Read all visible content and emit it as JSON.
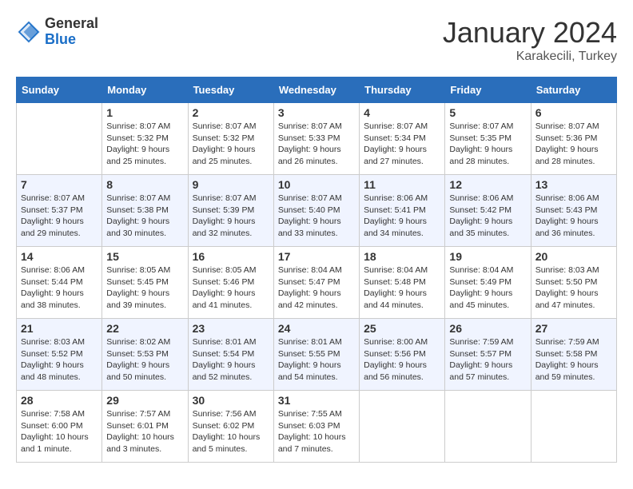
{
  "logo": {
    "general": "General",
    "blue": "Blue"
  },
  "title": {
    "month": "January 2024",
    "location": "Karakecili, Turkey"
  },
  "weekdays": [
    "Sunday",
    "Monday",
    "Tuesday",
    "Wednesday",
    "Thursday",
    "Friday",
    "Saturday"
  ],
  "weeks": [
    [
      {
        "day": null
      },
      {
        "day": 1,
        "sunrise": "8:07 AM",
        "sunset": "5:32 PM",
        "daylight": "9 hours and 25 minutes."
      },
      {
        "day": 2,
        "sunrise": "8:07 AM",
        "sunset": "5:32 PM",
        "daylight": "9 hours and 25 minutes."
      },
      {
        "day": 3,
        "sunrise": "8:07 AM",
        "sunset": "5:33 PM",
        "daylight": "9 hours and 26 minutes."
      },
      {
        "day": 4,
        "sunrise": "8:07 AM",
        "sunset": "5:34 PM",
        "daylight": "9 hours and 27 minutes."
      },
      {
        "day": 5,
        "sunrise": "8:07 AM",
        "sunset": "5:35 PM",
        "daylight": "9 hours and 28 minutes."
      },
      {
        "day": 6,
        "sunrise": "8:07 AM",
        "sunset": "5:36 PM",
        "daylight": "9 hours and 28 minutes."
      }
    ],
    [
      {
        "day": 7,
        "sunrise": "8:07 AM",
        "sunset": "5:37 PM",
        "daylight": "9 hours and 29 minutes."
      },
      {
        "day": 8,
        "sunrise": "8:07 AM",
        "sunset": "5:38 PM",
        "daylight": "9 hours and 30 minutes."
      },
      {
        "day": 9,
        "sunrise": "8:07 AM",
        "sunset": "5:39 PM",
        "daylight": "9 hours and 32 minutes."
      },
      {
        "day": 10,
        "sunrise": "8:07 AM",
        "sunset": "5:40 PM",
        "daylight": "9 hours and 33 minutes."
      },
      {
        "day": 11,
        "sunrise": "8:06 AM",
        "sunset": "5:41 PM",
        "daylight": "9 hours and 34 minutes."
      },
      {
        "day": 12,
        "sunrise": "8:06 AM",
        "sunset": "5:42 PM",
        "daylight": "9 hours and 35 minutes."
      },
      {
        "day": 13,
        "sunrise": "8:06 AM",
        "sunset": "5:43 PM",
        "daylight": "9 hours and 36 minutes."
      }
    ],
    [
      {
        "day": 14,
        "sunrise": "8:06 AM",
        "sunset": "5:44 PM",
        "daylight": "9 hours and 38 minutes."
      },
      {
        "day": 15,
        "sunrise": "8:05 AM",
        "sunset": "5:45 PM",
        "daylight": "9 hours and 39 minutes."
      },
      {
        "day": 16,
        "sunrise": "8:05 AM",
        "sunset": "5:46 PM",
        "daylight": "9 hours and 41 minutes."
      },
      {
        "day": 17,
        "sunrise": "8:04 AM",
        "sunset": "5:47 PM",
        "daylight": "9 hours and 42 minutes."
      },
      {
        "day": 18,
        "sunrise": "8:04 AM",
        "sunset": "5:48 PM",
        "daylight": "9 hours and 44 minutes."
      },
      {
        "day": 19,
        "sunrise": "8:04 AM",
        "sunset": "5:49 PM",
        "daylight": "9 hours and 45 minutes."
      },
      {
        "day": 20,
        "sunrise": "8:03 AM",
        "sunset": "5:50 PM",
        "daylight": "9 hours and 47 minutes."
      }
    ],
    [
      {
        "day": 21,
        "sunrise": "8:03 AM",
        "sunset": "5:52 PM",
        "daylight": "9 hours and 48 minutes."
      },
      {
        "day": 22,
        "sunrise": "8:02 AM",
        "sunset": "5:53 PM",
        "daylight": "9 hours and 50 minutes."
      },
      {
        "day": 23,
        "sunrise": "8:01 AM",
        "sunset": "5:54 PM",
        "daylight": "9 hours and 52 minutes."
      },
      {
        "day": 24,
        "sunrise": "8:01 AM",
        "sunset": "5:55 PM",
        "daylight": "9 hours and 54 minutes."
      },
      {
        "day": 25,
        "sunrise": "8:00 AM",
        "sunset": "5:56 PM",
        "daylight": "9 hours and 56 minutes."
      },
      {
        "day": 26,
        "sunrise": "7:59 AM",
        "sunset": "5:57 PM",
        "daylight": "9 hours and 57 minutes."
      },
      {
        "day": 27,
        "sunrise": "7:59 AM",
        "sunset": "5:58 PM",
        "daylight": "9 hours and 59 minutes."
      }
    ],
    [
      {
        "day": 28,
        "sunrise": "7:58 AM",
        "sunset": "6:00 PM",
        "daylight": "10 hours and 1 minute."
      },
      {
        "day": 29,
        "sunrise": "7:57 AM",
        "sunset": "6:01 PM",
        "daylight": "10 hours and 3 minutes."
      },
      {
        "day": 30,
        "sunrise": "7:56 AM",
        "sunset": "6:02 PM",
        "daylight": "10 hours and 5 minutes."
      },
      {
        "day": 31,
        "sunrise": "7:55 AM",
        "sunset": "6:03 PM",
        "daylight": "10 hours and 7 minutes."
      },
      {
        "day": null
      },
      {
        "day": null
      },
      {
        "day": null
      }
    ]
  ]
}
